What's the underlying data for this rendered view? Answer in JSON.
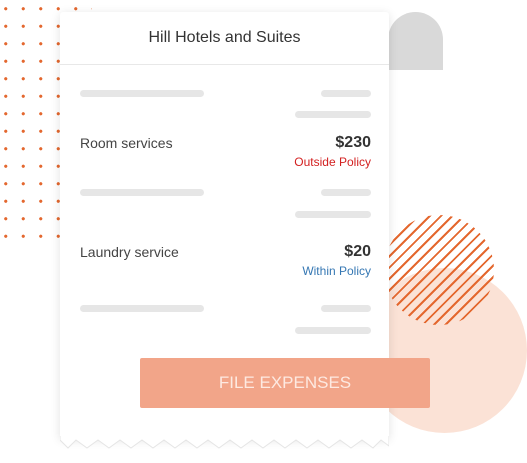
{
  "receipt": {
    "title": "Hill Hotels and Suites",
    "items": [
      {
        "name": "Room services",
        "amount": "$230",
        "status": "Outside Policy"
      },
      {
        "name": "Laundry service",
        "amount": "$20",
        "status": "Within Policy"
      }
    ]
  },
  "actions": {
    "file_expenses_label": "FILE EXPENSES"
  },
  "colors": {
    "accent_orange": "#e4682f",
    "button_fill": "#f2a589",
    "outside_policy": "#d32020",
    "within_policy": "#3577b3"
  }
}
